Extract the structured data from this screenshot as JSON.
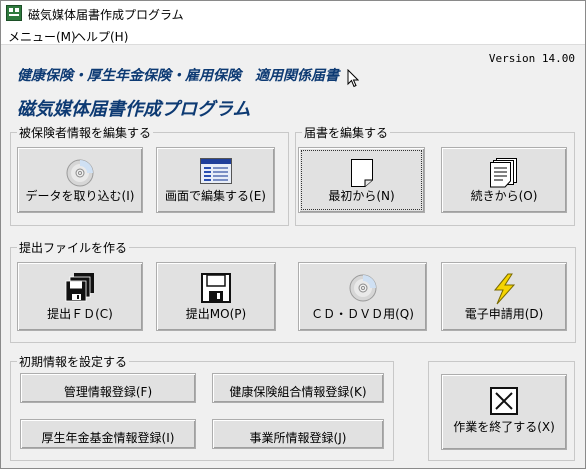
{
  "window": {
    "title": "磁気媒体届書作成プログラム"
  },
  "menu": [
    {
      "label": "メニュー(M)"
    },
    {
      "label": "ヘルプ(H)"
    }
  ],
  "version": "Version 14.00",
  "header": {
    "subtitle": "健康保険・厚生年金保険・雇用保険　適用関係届書",
    "title": "磁気媒体届書作成プログラム"
  },
  "groups": {
    "insured": {
      "label": "被保険者情報を編集する",
      "buttons": [
        {
          "label": "データを取り込む(I)",
          "icon": "cd-icon"
        },
        {
          "label": "画面で編集する(E)",
          "icon": "window-form-icon"
        }
      ]
    },
    "notice": {
      "label": "届書を編集する",
      "buttons": [
        {
          "label": "最初から(N)",
          "icon": "blank-page-icon"
        },
        {
          "label": "続きから(O)",
          "icon": "page-stack-icon"
        }
      ]
    },
    "submit": {
      "label": "提出ファイルを作る",
      "buttons": [
        {
          "label": "提出ＦＤ(C)",
          "icon": "floppy-stack-icon"
        },
        {
          "label": "提出MO(P)",
          "icon": "floppy-icon"
        },
        {
          "label": "ＣＤ・ＤＶＤ用(Q)",
          "icon": "cd-icon"
        },
        {
          "label": "電子申請用(D)",
          "icon": "lightning-icon"
        }
      ]
    },
    "initial": {
      "label": "初期情報を設定する",
      "buttons": [
        {
          "label": "管理情報登録(F)"
        },
        {
          "label": "健康保険組合情報登録(K)"
        },
        {
          "label": "厚生年金基金情報登録(I)"
        },
        {
          "label": "事業所情報登録(J)"
        }
      ]
    }
  },
  "exit": {
    "label": "作業を終了する(X)",
    "icon": "close-x-icon"
  },
  "colors": {
    "title_blue": "#0d3a73",
    "bolt_yellow": "#f5d400"
  }
}
